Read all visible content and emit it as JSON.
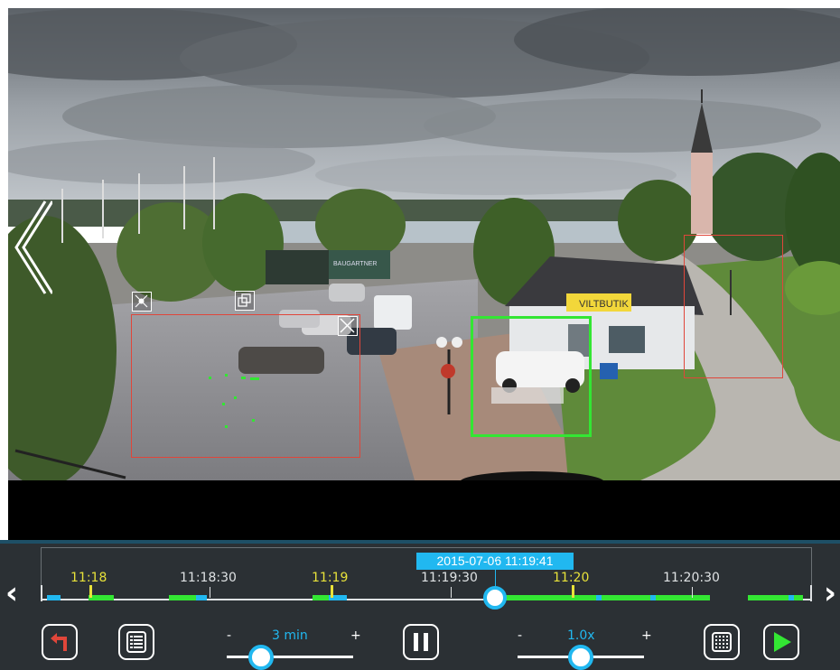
{
  "player": {
    "timestamp": "2015-07-06 11:19:41",
    "sign_text": "VILTBUTIK",
    "truck_text": "BAUGARTNER"
  },
  "timeline": {
    "labels": [
      {
        "text": "11:18",
        "major": true
      },
      {
        "text": "11:18:30",
        "major": false
      },
      {
        "text": "11:19",
        "major": true
      },
      {
        "text": "11:19:30",
        "major": false
      },
      {
        "text": "11:20",
        "major": true
      },
      {
        "text": "11:20:30",
        "major": false
      }
    ],
    "prev_arrow": "‹",
    "next_arrow": "›"
  },
  "controls": {
    "range": {
      "minus": "-",
      "value": "3 min",
      "plus": "+"
    },
    "speed": {
      "minus": "-",
      "value": "1.0x",
      "plus": "+"
    }
  },
  "icons": [
    "back-nav-icon",
    "back-arrow-icon",
    "list-icon",
    "pause-icon",
    "grid-icon",
    "play-icon",
    "activity-icon",
    "duplicate-icon",
    "close-icon"
  ],
  "colors": {
    "accent": "#21b8f0",
    "motion_green": "#33e633",
    "alarm_red": "#e0463a",
    "tick_yellow": "#e8e23a",
    "panel_bg": "#2b3034"
  }
}
